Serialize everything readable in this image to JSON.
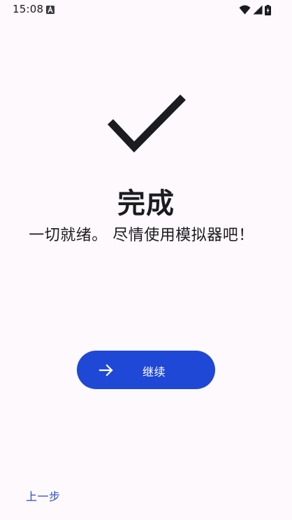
{
  "status_bar": {
    "time": "15:08",
    "icons": [
      "keyboard-a-icon",
      "wifi-icon",
      "cell-signal-icon",
      "battery-charging-icon"
    ]
  },
  "main": {
    "icon": "checkmark-icon",
    "title": "完成",
    "subtitle": "一切就绪。 尽情使用模拟器吧！"
  },
  "actions": {
    "continue_label": "继续",
    "continue_icon": "arrow-right-icon",
    "back_label": "上一步"
  },
  "colors": {
    "accent": "#1f48d6",
    "link": "#2a4fc4",
    "background": "#fdf9fd",
    "text": "#1c1b1f"
  }
}
